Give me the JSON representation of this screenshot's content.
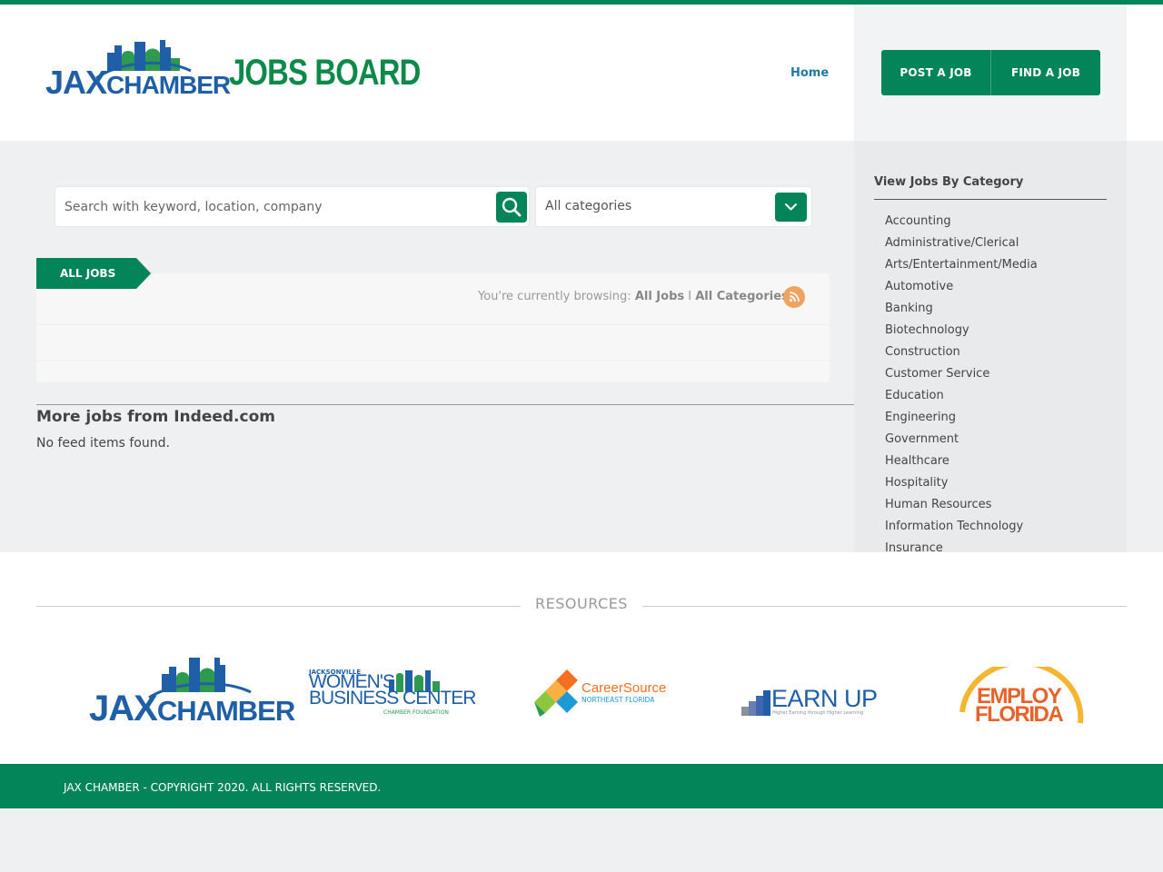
{
  "brand": {
    "logo_text_a": "JAX",
    "logo_text_b": "CHAMBER",
    "site_title": "JOBS BOARD",
    "colors": {
      "primary": "#048559",
      "link": "#1e7aa8",
      "brand_blue": "#1f5fa8",
      "rss": "#f0a35e"
    }
  },
  "nav": {
    "home": "Home",
    "post_job": "POST A JOB",
    "find_job": "FIND A JOB"
  },
  "search": {
    "placeholder": "Search with keyword, location, company",
    "category_value": "All categories",
    "search_icon": "search-icon",
    "dropdown_icon": "chevron-down-icon"
  },
  "jobs": {
    "tab_label": "ALL JOBS",
    "browsing_prefix": "You're currently browsing:",
    "browsing_jobs": "All Jobs",
    "browsing_sep": "I",
    "browsing_categories": "All Categories",
    "rss_icon": "rss-icon"
  },
  "indeed": {
    "title": "More jobs from Indeed.com",
    "empty": "No feed items found."
  },
  "sidebar": {
    "title": "View Jobs By Category",
    "categories": [
      "Accounting",
      "Administrative/Clerical",
      "Arts/Entertainment/Media",
      "Automotive",
      "Banking",
      "Biotechnology",
      "Construction",
      "Customer Service",
      "Education",
      "Engineering",
      "Government",
      "Healthcare",
      "Hospitality",
      "Human Resources",
      "Information Technology",
      "Insurance"
    ]
  },
  "resources": {
    "title": "RESOURCES",
    "logos": [
      {
        "a": "JAX",
        "b": "CHAMBER"
      },
      {
        "top": "JACKSONVILLE",
        "main1": "WOMEN'S",
        "main2": "BUSINESS CENTER",
        "sub": "CHAMBER FOUNDATION"
      },
      {
        "main": "CareerSource",
        "sub": "NORTHEAST FLORIDA"
      },
      {
        "main": "EARN UP",
        "sub": "Higher Earning through Higher Learning"
      },
      {
        "a": "EMPLOY",
        "b": "FLORIDA"
      }
    ]
  },
  "footer": {
    "copyright": "JAX CHAMBER - COPYRIGHT 2020. ALL RIGHTS RESERVED."
  }
}
